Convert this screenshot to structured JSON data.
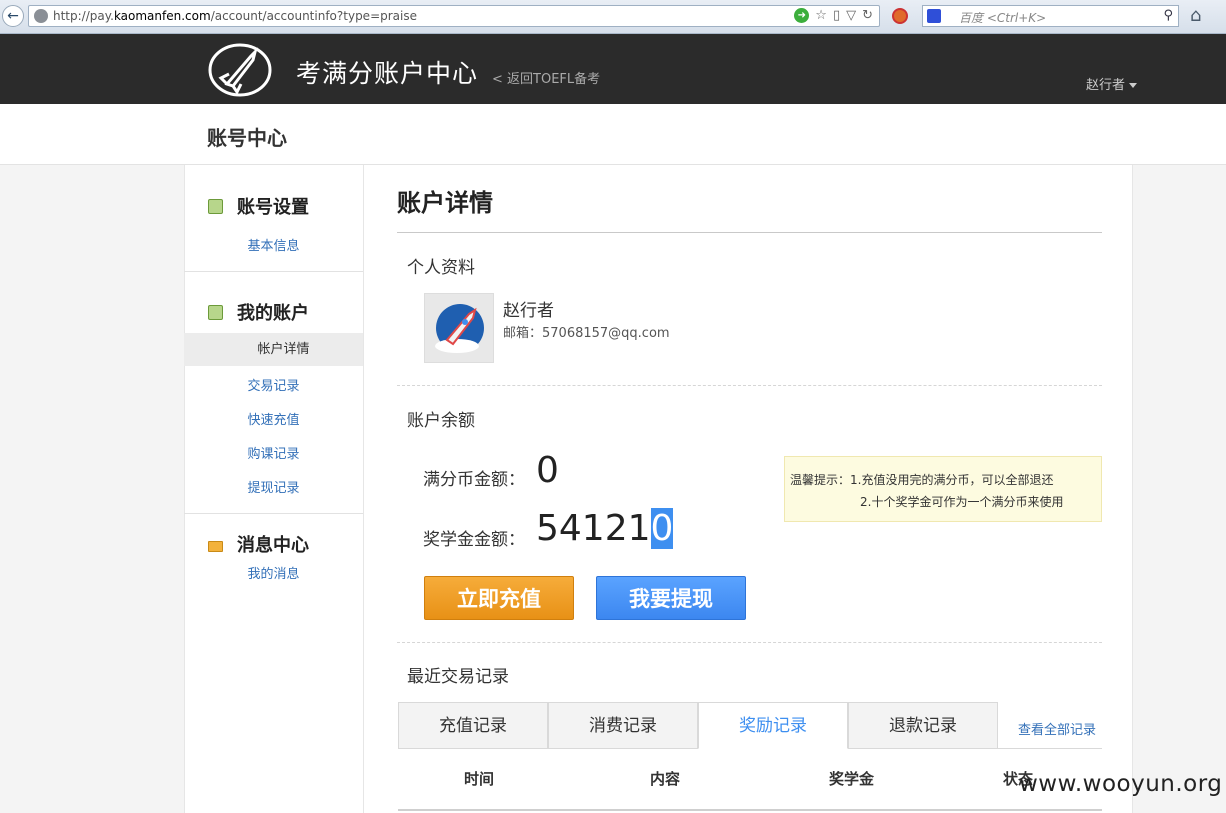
{
  "browser": {
    "url_prefix": "http://pay.",
    "url_domain": "kaomanfen.com",
    "url_path": "/account/accountinfo?type=praise",
    "search_placeholder": "百度 <Ctrl+K>"
  },
  "header": {
    "site_title": "考满分账户中心",
    "back_link": "< 返回TOEFL备考",
    "user_name": "赵行者"
  },
  "subheader": {
    "title": "账号中心"
  },
  "sidebar": {
    "sections": [
      {
        "title": "账号设置",
        "icon": "user-card-icon",
        "items": [
          "基本信息"
        ]
      },
      {
        "title": "我的账户",
        "icon": "user-card-icon",
        "items": [
          "帐户详情",
          "交易记录",
          "快速充值",
          "购课记录",
          "提现记录"
        ],
        "active": "帐户详情"
      },
      {
        "title": "消息中心",
        "icon": "mail-icon",
        "items": [
          "我的消息"
        ]
      }
    ]
  },
  "main": {
    "title": "账户详情",
    "profile": {
      "heading": "个人资料",
      "name": "赵行者",
      "email": "邮箱：57068157@qq.com"
    },
    "balance": {
      "heading": "账户余额",
      "coin_label": "满分币金额：",
      "coin_value": "0",
      "scholarship_label": "奖学金金额：",
      "scholarship_value_main": "54121",
      "scholarship_value_highlight": "0"
    },
    "tip": {
      "line1": "温馨提示：1.充值没用完的满分币，可以全部退还",
      "line2": "2.十个奖学金可作为一个满分币来使用"
    },
    "buttons": {
      "recharge": "立即充值",
      "withdraw": "我要提现"
    },
    "transactions": {
      "heading": "最近交易记录",
      "tabs": [
        "充值记录",
        "消费记录",
        "奖励记录",
        "退款记录"
      ],
      "active_tab": "奖励记录",
      "view_all": "查看全部记录",
      "columns": [
        "时间",
        "内容",
        "奖学金",
        "状态"
      ]
    }
  },
  "watermark": "www.wooyun.org",
  "colors": {
    "header_bg": "#2b2b2b",
    "accent_blue": "#3e8ff0",
    "accent_orange": "#e89116",
    "link": "#3370b8"
  }
}
